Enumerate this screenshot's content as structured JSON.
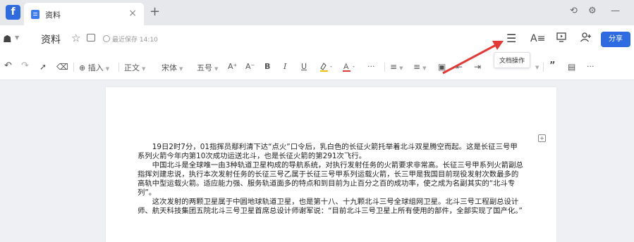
{
  "titlebar": {
    "tab_title": "资料",
    "close": "×",
    "new_tab": "+",
    "controls": [
      "⟲",
      "⚙",
      "—"
    ]
  },
  "header": {
    "doc_name": "资料",
    "saved_status": "最近保存 14:10",
    "share_label": "分享",
    "icons": [
      "menu-icon",
      "text-format-icon",
      "present-icon",
      "add-user-icon"
    ]
  },
  "toolbar": {
    "insert_label": "插入",
    "paragraph_style": "正文",
    "font_family": "宋体",
    "font_size": "五号",
    "font_grow": "A⁺",
    "font_shrink": "A⁻",
    "bold": "B",
    "italic": "I",
    "underline": "U",
    "more": "···"
  },
  "tooltip": {
    "text": "文档操作"
  },
  "document": {
    "paragraphs": [
      "19日2时7分，01指挥员鄢利清下达“点火”口令后，乳白色的长征火箭托举着北斗双星腾空而起。这是长征三号甲系列火箭今年内第10次成功运送北斗，也是长征火箭的第291次飞行。",
      "中国北斗是全球唯一由3种轨道卫星构成的导航系统，对执行发射任务的火箭要求非常高。长征三号甲系列火箭副总指挥刘建忠说，执行本次发射任务的长征三号乙属于长征三号甲系列运载火箭，长三甲是我国目前现役发射次数最多的高轨中型运载火箭。适应能力强、服务轨道面多的特点和到目前为止百分之百的成功率，使之成为名副其实的“北斗专列”。",
      "这次发射的两颗卫星属于中圆地球轨道卫星，也是第十八、十九颗北斗三号全球组网卫星。北斗三号工程副总设计师、航天科技集团五院北斗三号卫星首席总设计师谢军说：“目前北斗三号卫星上所有使用的部件，全部实现了国产化。”"
    ]
  },
  "colors": {
    "accent": "#2f6be0",
    "arrow": "#e53935",
    "highlight_bar": "#f0c000",
    "font_color_bar": "#e53935"
  }
}
